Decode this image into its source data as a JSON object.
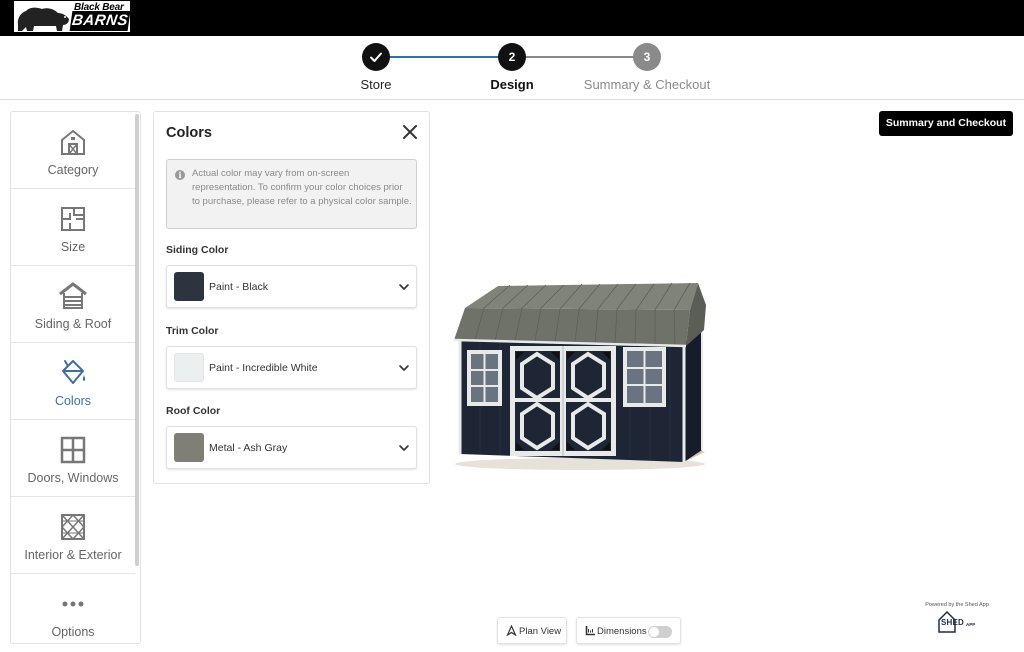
{
  "brand": {
    "top": "Black Bear",
    "main": "BARNS"
  },
  "stepper": {
    "steps": [
      {
        "number": "",
        "label": "Store",
        "state": "complete"
      },
      {
        "number": "2",
        "label": "Design",
        "state": "active"
      },
      {
        "number": "3",
        "label": "Summary & Checkout",
        "state": "pending"
      }
    ]
  },
  "sidebar": {
    "items": [
      {
        "label": "Category",
        "icon": "barn-icon"
      },
      {
        "label": "Size",
        "icon": "floorplan-icon"
      },
      {
        "label": "Siding & Roof",
        "icon": "roof-icon"
      },
      {
        "label": "Colors",
        "icon": "paint-bucket-icon",
        "active": true
      },
      {
        "label": "Doors, Windows",
        "icon": "window-icon"
      },
      {
        "label": "Interior & Exterior",
        "icon": "lattice-icon"
      },
      {
        "label": "Options",
        "icon": "more-icon"
      }
    ]
  },
  "colors_panel": {
    "title": "Colors",
    "notice": "Actual color may vary from on-screen representation. To confirm your color choices prior to purchase, please refer to a physical color sample.",
    "fields": [
      {
        "label": "Siding Color",
        "value": "Paint - Black",
        "swatch": "#2d3440"
      },
      {
        "label": "Trim Color",
        "value": "Paint - Incredible White",
        "swatch": "#ecefef"
      },
      {
        "label": "Roof Color",
        "value": "Metal - Ash Gray",
        "swatch": "#7f7f76"
      }
    ]
  },
  "header_actions": {
    "checkout_label": "Summary and Checkout"
  },
  "viewer_controls": {
    "plan_view_label": "Plan View",
    "dimensions_label": "Dimensions",
    "dimensions_on": false
  },
  "footer": {
    "powered_by": "Powered by the Shed App",
    "logo_text": "SHED",
    "logo_sub": "APP"
  },
  "colors": {
    "accent": "#2f6fb3",
    "active_nav": "#3f6f9e",
    "siding": "#1e2636",
    "trim": "#e8eaea",
    "roof": "#6f7269"
  }
}
